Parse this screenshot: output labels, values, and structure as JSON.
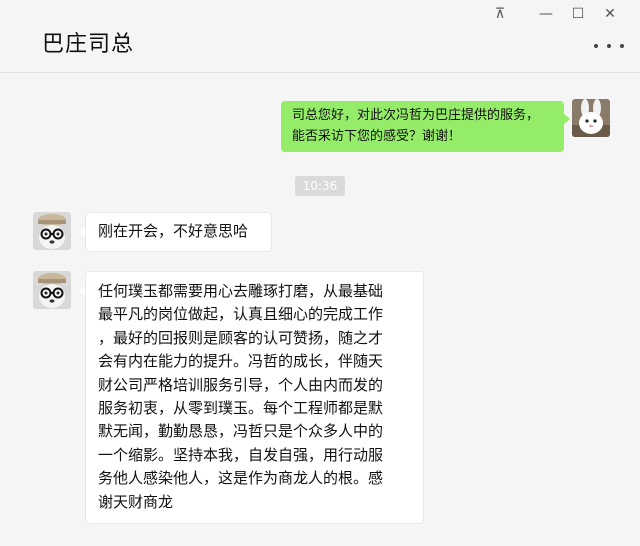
{
  "window": {
    "title": "巴庄司总",
    "pin_glyph": "⊼",
    "min_glyph": "—",
    "max_glyph": "☐",
    "close_glyph": "✕"
  },
  "chat": {
    "timestamp": "10:36",
    "messages": [
      {
        "side": "right",
        "text": "司总您好，对此次冯哲为巴庄提供的服务，\n能否采访下您的感受？谢谢！"
      },
      {
        "side": "left",
        "text": "刚在开会，不好意思哈"
      },
      {
        "side": "left",
        "text": "任何璞玉都需要用心去雕琢打磨，从最基础\n最平凡的岗位做起，认真且细心的完成工作\n，最好的回报则是顾客的认可赞扬，随之才\n会有内在能力的提升。冯哲的成长，伴随天\n财公司严格培训服务引导，个人由内而发的\n服务初衷，从零到璞玉。每个工程师都是默\n默无闻，勤勤恳恳，冯哲只是个众多人中的\n一个缩影。坚持本我，自发自强，用行动服\n务他人感染他人，这是作为商龙人的根。感\n谢天财商龙"
      }
    ]
  },
  "colors": {
    "sent_bubble": "#95ec69",
    "received_bubble": "#ffffff",
    "background": "#f5f5f5"
  }
}
